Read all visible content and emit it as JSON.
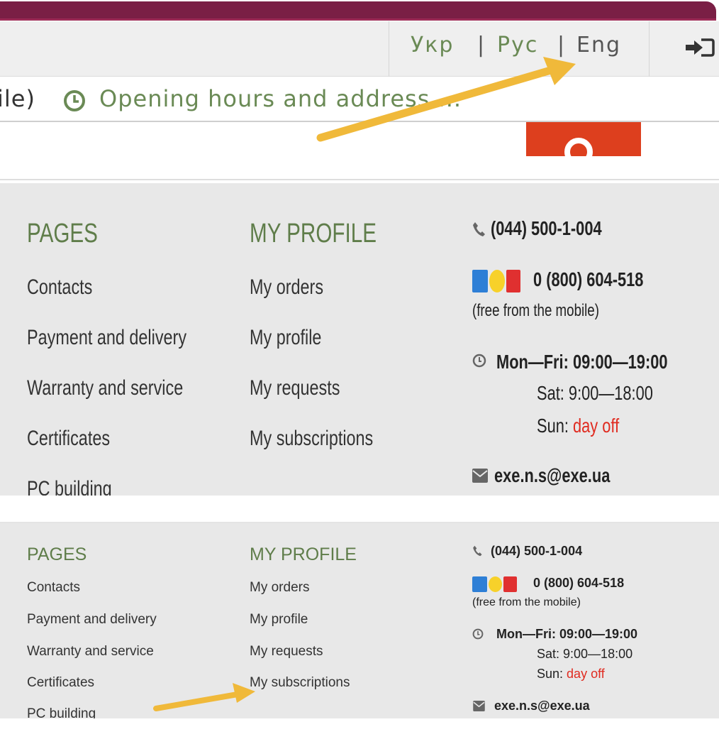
{
  "header": {
    "languages": [
      "Укр",
      "Рус",
      "Eng"
    ],
    "separator": "|",
    "hours_prefix": "ile)",
    "hours_link": "Opening hours and address ..."
  },
  "footer": {
    "pages_title": "PAGES",
    "profile_title": "MY PROFILE",
    "pages": [
      "Contacts",
      "Payment and delivery",
      "Warranty and service",
      "Certificates",
      "PC building"
    ],
    "profile": [
      "My orders",
      "My profile",
      "My requests",
      "My subscriptions"
    ],
    "phone": "(044) 500-1-004",
    "mobile_phone": "0 (800) 604-518",
    "mobile_note": "(free from the mobile)",
    "weekdays": "Mon—Fri: 09:00—19:00",
    "saturday": "Sat: 9:00—18:00",
    "sunday_label": "Sun:",
    "sunday_value": "day off",
    "email": "exe.n.s@exe.ua"
  },
  "colors": {
    "brand_bar": "#7a1f45",
    "accent_green": "#6a8a55",
    "search_button": "#dd3f1e",
    "annotation_arrow": "#f0b93a",
    "day_off": "#e02b20"
  },
  "icons": [
    "login-icon",
    "clock-icon",
    "search-icon",
    "phone-icon",
    "kyivstar-icon",
    "lifecell-icon",
    "vodafone-icon",
    "envelope-icon",
    "annotation-arrow"
  ]
}
